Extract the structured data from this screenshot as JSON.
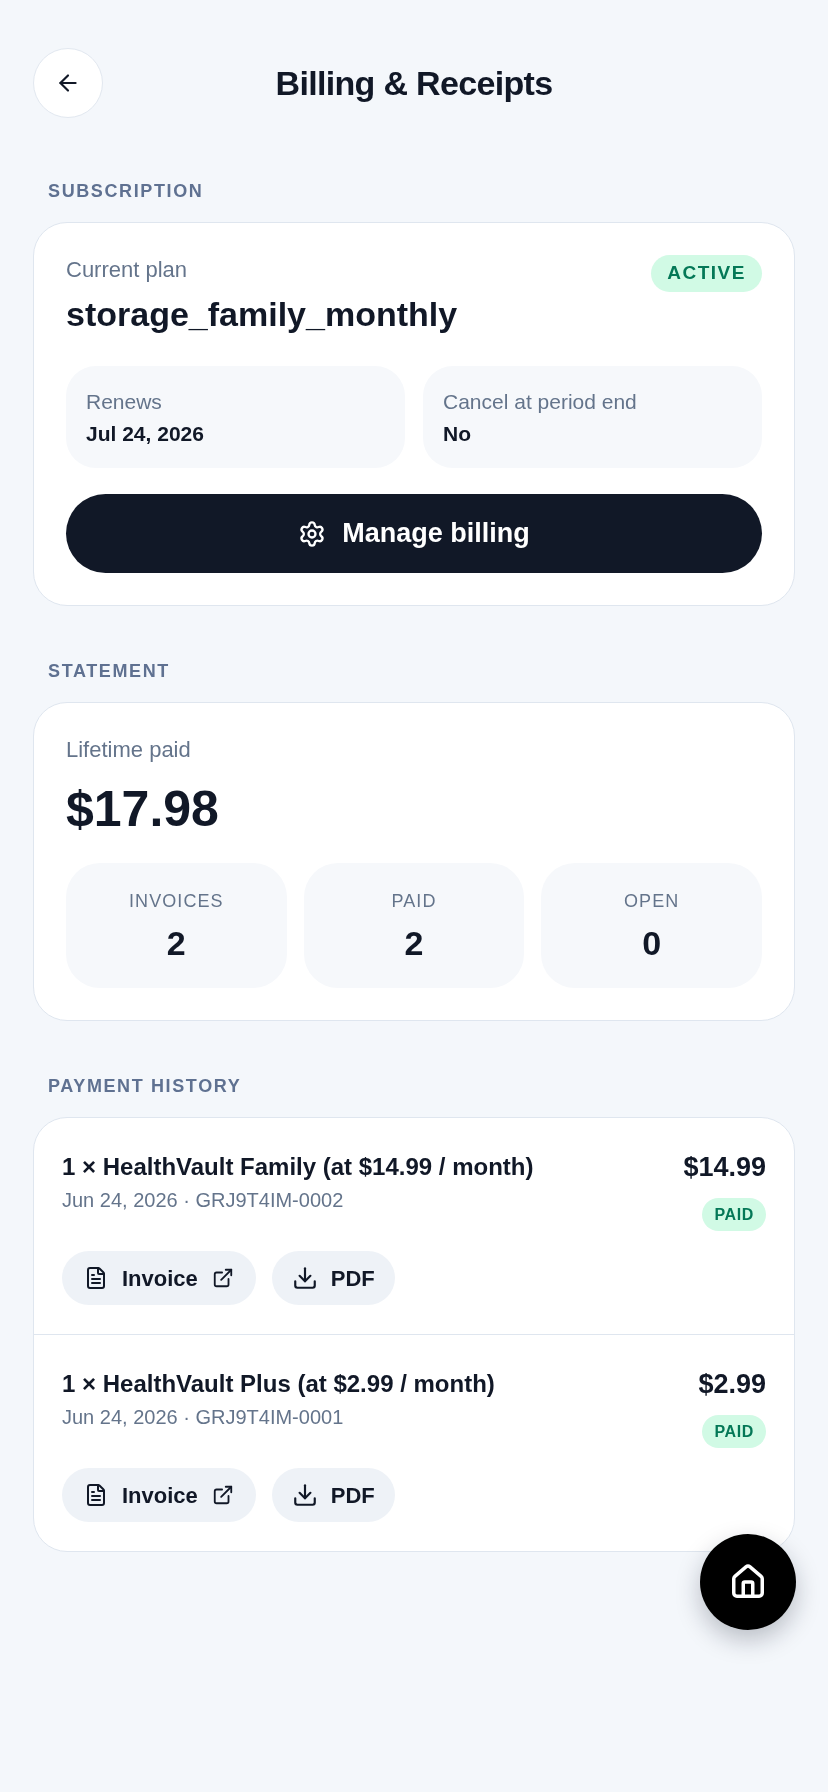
{
  "header": {
    "title": "Billing & Receipts"
  },
  "subscription": {
    "section_label": "SUBSCRIPTION",
    "plan_label": "Current plan",
    "plan": "storage_family_monthly",
    "status": {
      "label": "ACTIVE",
      "kind": "success"
    },
    "details": [
      {
        "label": "Renews",
        "value": "Jul 24, 2026"
      },
      {
        "label": "Cancel at period end",
        "value": "No"
      }
    ],
    "button": "Manage billing"
  },
  "statement": {
    "section_label": "STATEMENT",
    "total_label": "Lifetime paid",
    "total": "$17.98",
    "stats": [
      {
        "label": "INVOICES",
        "value": "2"
      },
      {
        "label": "PAID",
        "value": "2"
      },
      {
        "label": "OPEN",
        "value": "0"
      }
    ]
  },
  "payment_history": {
    "section_label": "PAYMENT HISTORY",
    "payments": [
      {
        "description": "1 × HealthVault Family (at $14.99 / month)",
        "meta": "Jun 24, 2026 · GRJ9T4IM-0002",
        "amount": "$14.99",
        "status": {
          "label": "PAID",
          "kind": "success"
        },
        "actions": [
          {
            "label": "Invoice",
            "kind": "invoice"
          },
          {
            "label": "PDF",
            "kind": "pdf"
          }
        ]
      },
      {
        "description": "1 × HealthVault Plus (at $2.99 / month)",
        "meta": "Jun 24, 2026 · GRJ9T4IM-0001",
        "amount": "$2.99",
        "status": {
          "label": "PAID",
          "kind": "success"
        },
        "actions": [
          {
            "label": "Invoice",
            "kind": "invoice"
          },
          {
            "label": "PDF",
            "kind": "pdf"
          }
        ]
      }
    ]
  }
}
